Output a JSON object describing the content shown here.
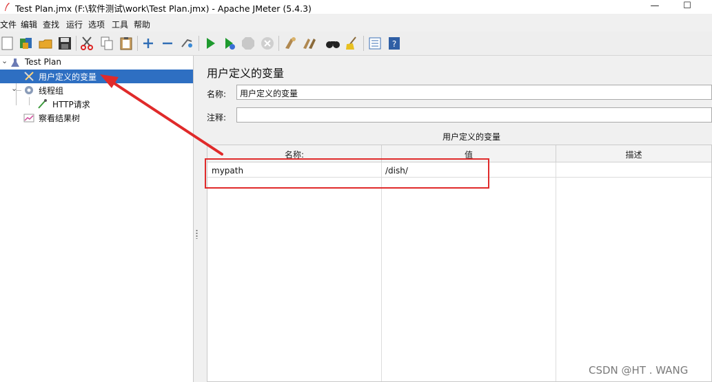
{
  "window": {
    "title": "Test Plan.jmx (F:\\软件测试\\work\\Test Plan.jmx) - Apache JMeter (5.4.3)",
    "minimize_glyph": "—",
    "maximize_glyph": "☐"
  },
  "menu": [
    "文件",
    "编辑",
    "查找",
    "运行",
    "选项",
    "工具",
    "帮助"
  ],
  "toolbar": {
    "icons": [
      "new-icon",
      "templates-icon",
      "open-icon",
      "save-icon",
      "cut-icon",
      "copy-icon",
      "paste-icon",
      "expand-icon",
      "collapse-icon",
      "toggle-icon",
      "start-icon",
      "start-no-pause-icon",
      "stop-icon",
      "shutdown-icon",
      "clear-icon",
      "clear-all-icon",
      "search-icon",
      "reset-search-icon",
      "function-helper-icon",
      "help-icon"
    ]
  },
  "tree": {
    "nodes": [
      {
        "label": "Test Plan",
        "icon": "test-plan-icon",
        "expanded": true
      },
      {
        "label": "用户定义的变量",
        "icon": "tools-icon",
        "selected": true
      },
      {
        "label": "线程组",
        "icon": "gear-icon",
        "expanded": true
      },
      {
        "label": "HTTP请求",
        "icon": "pipette-icon"
      },
      {
        "label": "察看结果树",
        "icon": "chart-icon"
      }
    ]
  },
  "panel": {
    "title": "用户定义的变量",
    "name_label": "名称:",
    "name_value": "用户定义的变量",
    "comment_label": "注释:",
    "comment_value": "",
    "table_title": "用户定义的变量",
    "columns": [
      "名称:",
      "值",
      "描述"
    ],
    "rows": [
      {
        "name": "mypath",
        "value": "/dish/",
        "description": ""
      }
    ]
  },
  "annotations": {
    "highlight_color": "#e02a2a",
    "watermark": "CSDN @HT . WANG"
  },
  "colors": {
    "selection": "#2e6fc2",
    "accent_red": "#e02a2a"
  }
}
